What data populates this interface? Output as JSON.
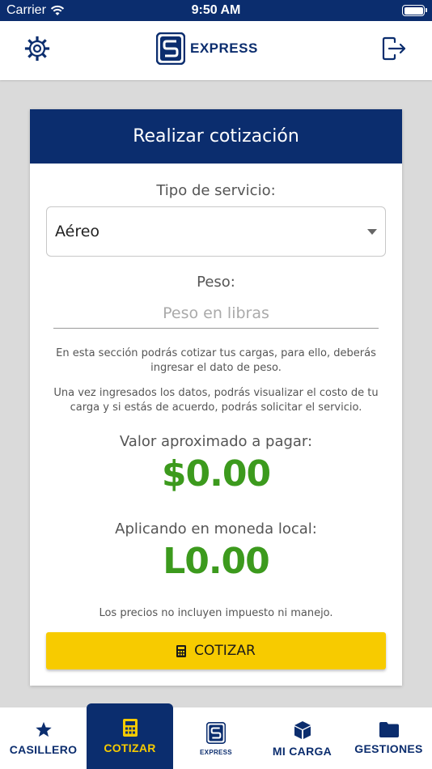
{
  "status_bar": {
    "carrier": "Carrier",
    "time": "9:50 AM"
  },
  "header": {
    "logo_text": "EXPRESS",
    "icons": [
      "gear-icon",
      "logout-icon"
    ]
  },
  "colors": {
    "brand_navy": "#0b2d6e",
    "accent_yellow": "#f7cb00",
    "amount_green": "#3c9a1d"
  },
  "card": {
    "title": "Realizar cotización",
    "service_label": "Tipo de servicio:",
    "service_value": "Aéreo",
    "weight_label": "Peso:",
    "weight_placeholder": "Peso en libras",
    "info_1": "En esta sección podrás cotizar tus cargas, para ello, deberás ingresar el dato de peso.",
    "info_2": "Una vez ingresados los datos, podrás visualizar el costo de tu carga y si estás de acuerdo, podrás solicitar el servicio.",
    "approx_label": "Valor aproximado a pagar:",
    "approx_value": "$0.00",
    "local_label": "Aplicando en moneda local:",
    "local_value": "L0.00",
    "disclaimer": "Los precios no incluyen impuesto ni manejo.",
    "button_label": "COTIZAR"
  },
  "tabs": [
    {
      "label": "CASILLERO",
      "icon": "star-icon"
    },
    {
      "label": "COTIZAR",
      "icon": "calculator-icon",
      "active": true
    },
    {
      "label": "EXPRESS",
      "icon": "express-logo-icon"
    },
    {
      "label": "MI CARGA",
      "icon": "box-icon"
    },
    {
      "label": "GESTIONES",
      "icon": "folder-icon"
    }
  ]
}
